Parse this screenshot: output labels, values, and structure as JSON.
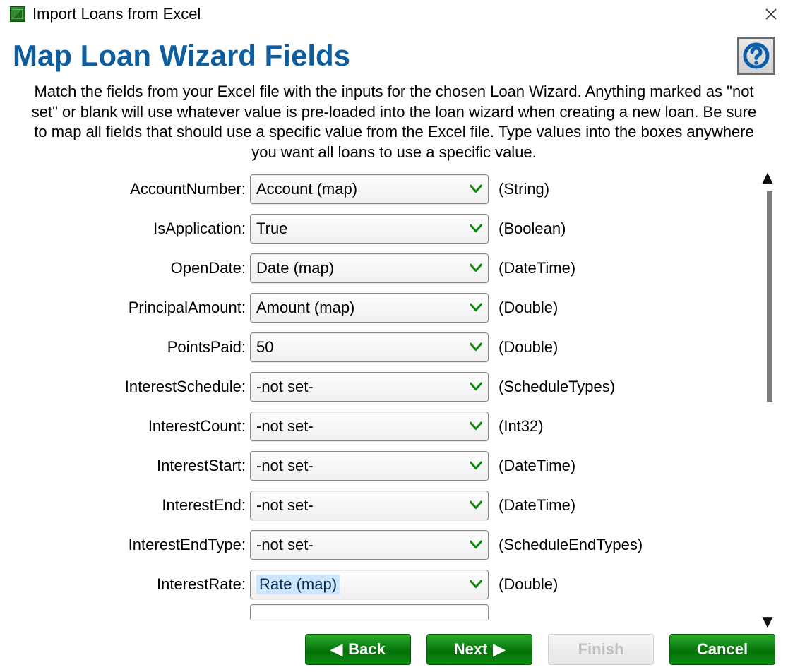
{
  "window": {
    "title": "Import Loans from Excel"
  },
  "page": {
    "heading": "Map Loan Wizard Fields",
    "description": "Match the fields from your Excel file with the inputs for the chosen Loan Wizard. Anything marked as \"not set\" or blank will use whatever value is pre-loaded into the loan wizard when creating a new loan. Be sure to map all fields that should use a specific value from the Excel file. Type values into the boxes anywhere you want all loans to use a specific value."
  },
  "fields": [
    {
      "label": "AccountNumber:",
      "value": "Account (map)",
      "type": "(String)",
      "selected": false
    },
    {
      "label": "IsApplication:",
      "value": "True",
      "type": "(Boolean)",
      "selected": false
    },
    {
      "label": "OpenDate:",
      "value": "Date (map)",
      "type": "(DateTime)",
      "selected": false
    },
    {
      "label": "PrincipalAmount:",
      "value": "Amount (map)",
      "type": "(Double)",
      "selected": false
    },
    {
      "label": "PointsPaid:",
      "value": "50",
      "type": "(Double)",
      "selected": false
    },
    {
      "label": "InterestSchedule:",
      "value": "-not set-",
      "type": "(ScheduleTypes)",
      "selected": false
    },
    {
      "label": "InterestCount:",
      "value": "-not set-",
      "type": "(Int32)",
      "selected": false
    },
    {
      "label": "InterestStart:",
      "value": "-not set-",
      "type": "(DateTime)",
      "selected": false
    },
    {
      "label": "InterestEnd:",
      "value": "-not set-",
      "type": "(DateTime)",
      "selected": false
    },
    {
      "label": "InterestEndType:",
      "value": "-not set-",
      "type": "(ScheduleEndTypes)",
      "selected": false
    },
    {
      "label": "InterestRate:",
      "value": "Rate (map)",
      "type": "(Double)",
      "selected": true
    }
  ],
  "buttons": {
    "back": "Back",
    "next": "Next",
    "finish": "Finish",
    "cancel": "Cancel"
  }
}
